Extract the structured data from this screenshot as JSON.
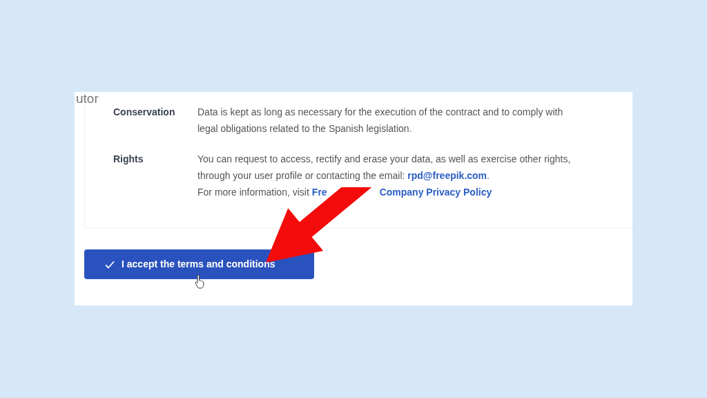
{
  "header_fragment": "utor",
  "rows": [
    {
      "label": "Conservation",
      "lines": [
        "Data is kept as long as necessary for the execution of the contract and to comply with",
        "legal obligations related to the Spanish legislation."
      ]
    },
    {
      "label": "Rights",
      "lines": [
        "You can request to access, rectify and erase your data, as well as exercise other rights,",
        "through your user profile or contacting the email: **rpd@freepik.com**."
      ],
      "more_text": "For more information, visit",
      "link_parts": [
        "Fre",
        "Company Privacy Policy"
      ]
    }
  ],
  "accept_button": {
    "label": "I accept the terms and conditions"
  }
}
